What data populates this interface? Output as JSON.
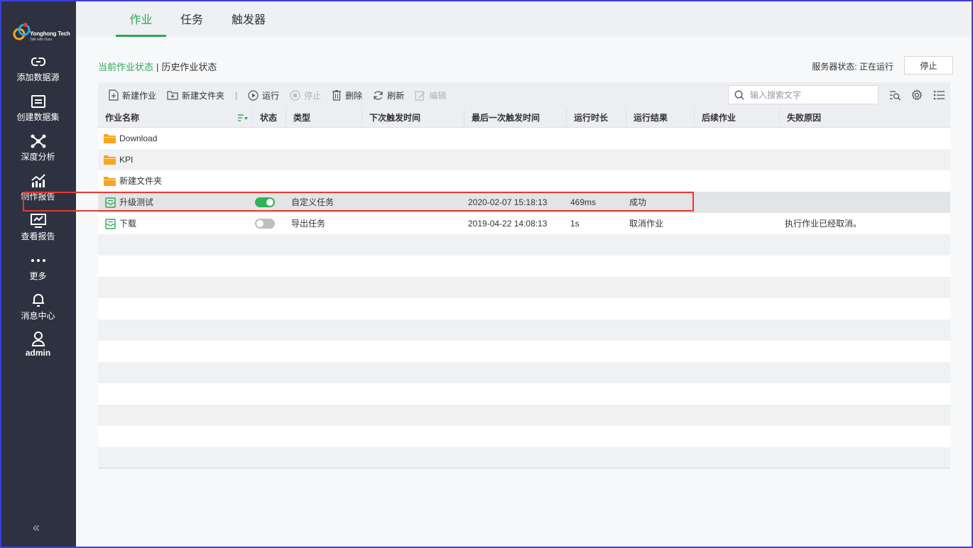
{
  "app": {
    "logo_text": "Yonghong Tech",
    "logo_sub": "Talk with Data"
  },
  "sidebar": {
    "items": [
      {
        "label": "添加数据源",
        "icon": "link-icon"
      },
      {
        "label": "创建数据集",
        "icon": "dataset-icon"
      },
      {
        "label": "深度分析",
        "icon": "analysis-icon"
      },
      {
        "label": "制作报告",
        "icon": "chart-icon"
      },
      {
        "label": "查看报告",
        "icon": "view-report-icon"
      },
      {
        "label": "更多",
        "icon": "more-icon"
      },
      {
        "label": "消息中心",
        "icon": "bell-icon"
      },
      {
        "label": "admin",
        "icon": "user-icon"
      }
    ],
    "collapse": "«"
  },
  "tabs": [
    {
      "label": "作业",
      "active": true
    },
    {
      "label": "任务",
      "active": false
    },
    {
      "label": "触发器",
      "active": false
    }
  ],
  "status_links": {
    "current": "当前作业状态",
    "separator": "|",
    "history": "历史作业状态"
  },
  "server": {
    "label": "服务器状态:",
    "value": "正在运行",
    "stop_button": "停止"
  },
  "toolbar": {
    "new_job": "新建作业",
    "new_folder": "新建文件夹",
    "divider": "|",
    "run": "运行",
    "stop": "停止",
    "delete": "删除",
    "refresh": "刷新",
    "edit": "编辑",
    "search_placeholder": "输入搜索文字"
  },
  "table": {
    "columns": [
      "作业名称",
      "状态",
      "类型",
      "下次触发时间",
      "最后一次触发时间",
      "运行时长",
      "运行结果",
      "后续作业",
      "失败原因"
    ],
    "rows": [
      {
        "kind": "folder",
        "name": "Download"
      },
      {
        "kind": "folder",
        "name": "KPI"
      },
      {
        "kind": "folder",
        "name": "新建文件夹"
      },
      {
        "kind": "job",
        "name": "升级测试",
        "enabled": true,
        "type": "自定义任务",
        "next": "",
        "last": "2020-02-07 15:18:13",
        "duration": "469ms",
        "result": "成功",
        "follow": "",
        "reason": ""
      },
      {
        "kind": "job",
        "name": "下载",
        "enabled": false,
        "type": "导出任务",
        "next": "",
        "last": "2019-04-22 14:08:13",
        "duration": "1s",
        "result": "取消作业",
        "follow": "",
        "reason": "执行作业已经取消。"
      }
    ]
  },
  "colors": {
    "accent": "#2fa657",
    "sidebar_bg": "#2e3240",
    "folder": "#f5a623",
    "highlight": "#e53935"
  }
}
